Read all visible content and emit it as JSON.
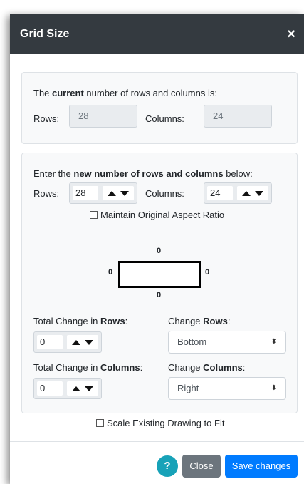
{
  "dialog": {
    "title": "Grid Size",
    "close_icon": "×"
  },
  "current": {
    "intro_prefix": "The ",
    "intro_bold": "current",
    "intro_suffix": " number of rows and columns is:",
    "rows_label": "Rows:",
    "rows_value": "28",
    "columns_label": "Columns:",
    "columns_value": "24"
  },
  "new_size": {
    "intro_prefix": "Enter the ",
    "intro_bold": "new number of rows and columns",
    "intro_suffix": " below:",
    "rows_label": "Rows:",
    "rows_value": "28",
    "columns_label": "Columns:",
    "columns_value": "24",
    "aspect_label": "Maintain Original Aspect Ratio",
    "aspect_checked": false
  },
  "preview": {
    "top": "0",
    "left": "0",
    "right": "0",
    "bottom": "0"
  },
  "change": {
    "rows_total_prefix": "Total Change in ",
    "rows_total_bold": "Rows",
    "rows_total_suffix": ":",
    "rows_total_value": "0",
    "change_rows_prefix": "Change ",
    "change_rows_bold": "Rows",
    "change_rows_suffix": ":",
    "change_rows_selected": "Bottom",
    "cols_total_prefix": "Total Change in ",
    "cols_total_bold": "Columns",
    "cols_total_suffix": ":",
    "cols_total_value": "0",
    "change_cols_prefix": "Change ",
    "change_cols_bold": "Columns",
    "change_cols_suffix": ":",
    "change_cols_selected": "Right"
  },
  "scale": {
    "label": "Scale Existing Drawing to Fit",
    "checked": false
  },
  "footer": {
    "help_label": "?",
    "close_label": "Close",
    "save_label": "Save changes"
  }
}
